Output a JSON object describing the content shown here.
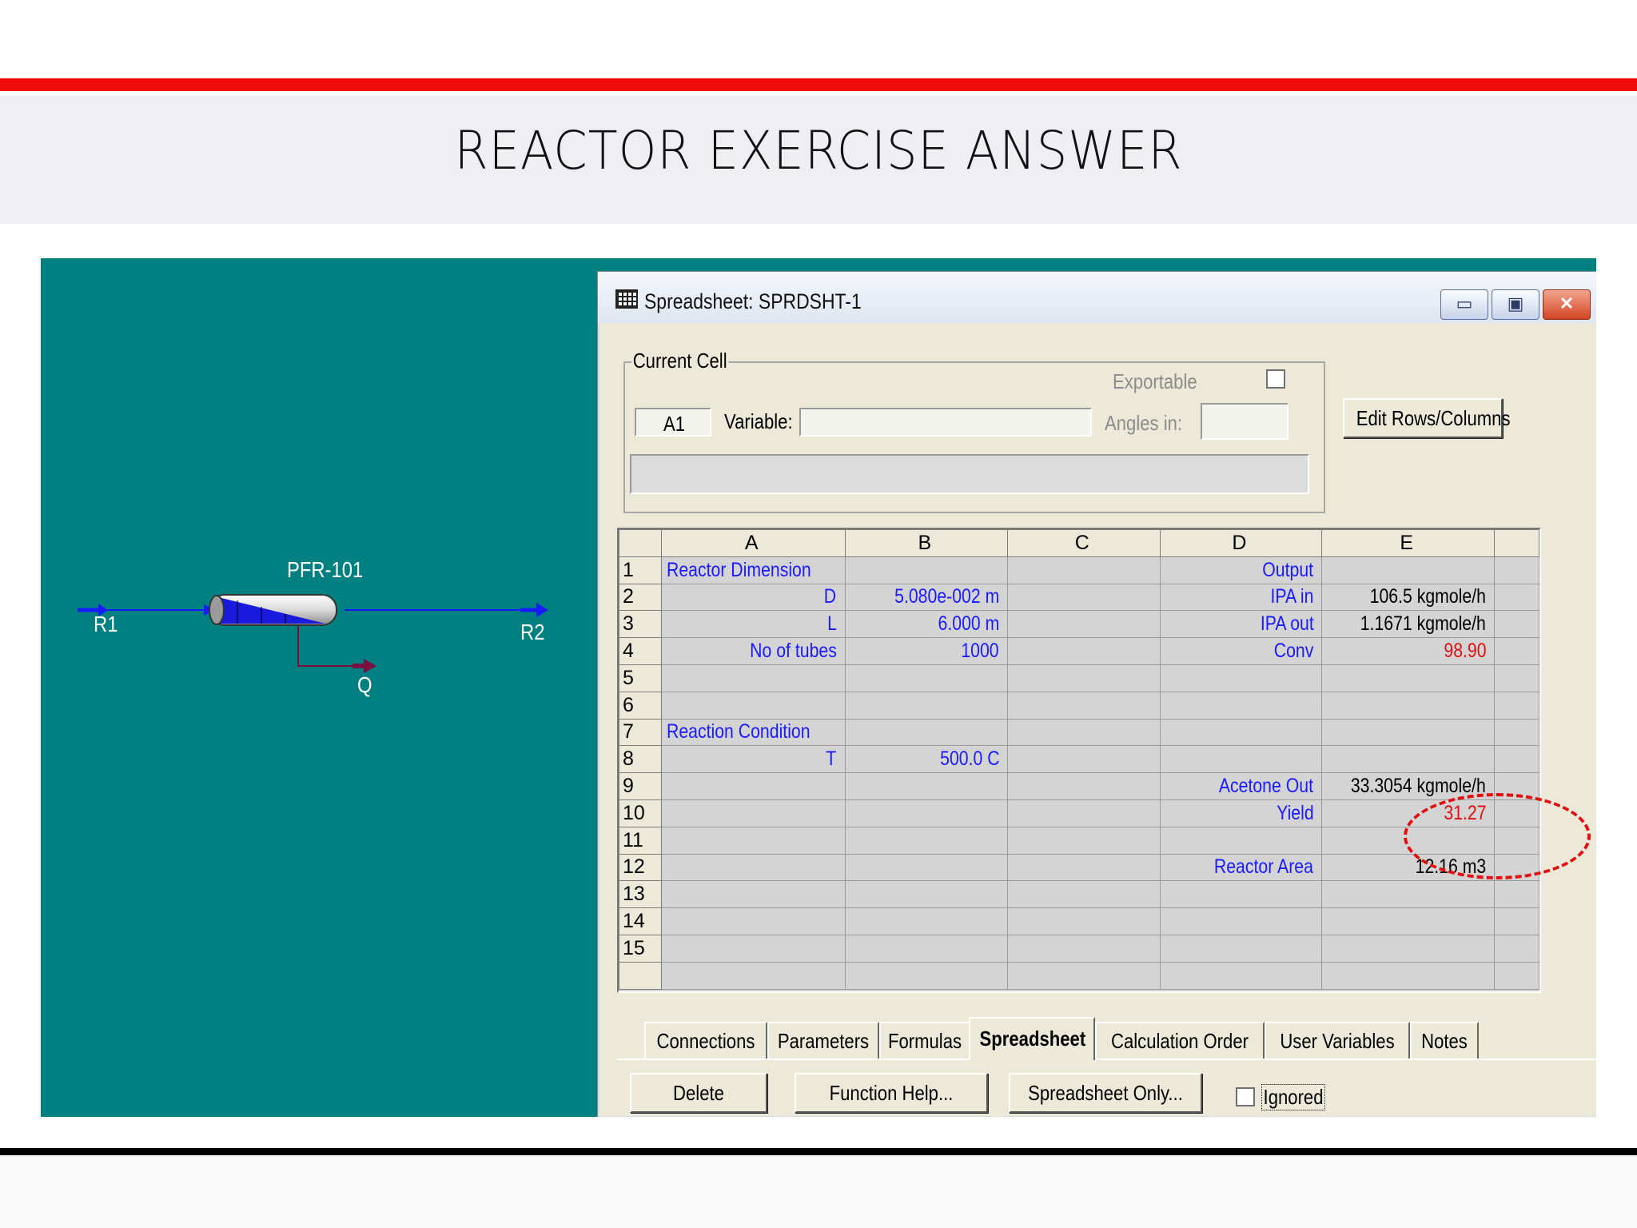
{
  "slide": {
    "title": "REACTOR EXERCISE ANSWER"
  },
  "flowsheet": {
    "unit": "PFR-101",
    "streams": {
      "inlet": "R1",
      "outlet": "R2",
      "energy": "Q"
    }
  },
  "window": {
    "title": "Spreadsheet: SPRDSHT-1",
    "buttons": {
      "minimize": "▭",
      "restore": "▣",
      "close": "✕"
    }
  },
  "current_cell": {
    "legend": "Current Cell",
    "cell": "A1",
    "variable_label": "Variable:",
    "variable_value": "",
    "exportable_label": "Exportable",
    "angles_label": "Angles in:",
    "angles_value": "",
    "formula_bar": ""
  },
  "edit_rows_button": "Edit Rows/Columns",
  "sheet": {
    "columns": [
      "A",
      "B",
      "C",
      "D",
      "E"
    ],
    "rows": [
      {
        "n": "1",
        "a": "Reactor Dimension",
        "b": "",
        "c": "",
        "d": "Output",
        "e": ""
      },
      {
        "n": "2",
        "a": "D",
        "b": "5.080e-002 m",
        "c": "",
        "d": "IPA in",
        "e": "106.5 kgmole/h"
      },
      {
        "n": "3",
        "a": "L",
        "b": "6.000 m",
        "c": "",
        "d": "IPA out",
        "e": "1.1671 kgmole/h"
      },
      {
        "n": "4",
        "a": "No of tubes",
        "b": "1000",
        "c": "",
        "d": "Conv",
        "e": "98.90"
      },
      {
        "n": "5",
        "a": "",
        "b": "",
        "c": "",
        "d": "",
        "e": ""
      },
      {
        "n": "6",
        "a": "",
        "b": "",
        "c": "",
        "d": "",
        "e": ""
      },
      {
        "n": "7",
        "a": "Reaction Condition",
        "b": "",
        "c": "",
        "d": "",
        "e": ""
      },
      {
        "n": "8",
        "a": "T",
        "b": "500.0 C",
        "c": "",
        "d": "",
        "e": ""
      },
      {
        "n": "9",
        "a": "",
        "b": "",
        "c": "",
        "d": "Acetone Out",
        "e": "33.3054 kgmole/h"
      },
      {
        "n": "10",
        "a": "",
        "b": "",
        "c": "",
        "d": "Yield",
        "e": "31.27"
      },
      {
        "n": "11",
        "a": "",
        "b": "",
        "c": "",
        "d": "",
        "e": ""
      },
      {
        "n": "12",
        "a": "",
        "b": "",
        "c": "",
        "d": "Reactor Area",
        "e": "12.16 m3"
      },
      {
        "n": "13",
        "a": "",
        "b": "",
        "c": "",
        "d": "",
        "e": ""
      },
      {
        "n": "14",
        "a": "",
        "b": "",
        "c": "",
        "d": "",
        "e": ""
      },
      {
        "n": "15",
        "a": "",
        "b": "",
        "c": "",
        "d": "",
        "e": ""
      }
    ]
  },
  "tabs": [
    "Connections",
    "Parameters",
    "Formulas",
    "Spreadsheet",
    "Calculation Order",
    "User Variables",
    "Notes"
  ],
  "active_tab": "Spreadsheet",
  "footer": {
    "delete": "Delete",
    "function_help": "Function Help...",
    "spreadsheet_only": "Spreadsheet Only...",
    "ignored": "Ignored"
  },
  "colors": {
    "accent_red": "#f00a0a",
    "teal_background": "#008080",
    "label_blue": "#1a1aff",
    "highlight_red": "#e01010"
  }
}
